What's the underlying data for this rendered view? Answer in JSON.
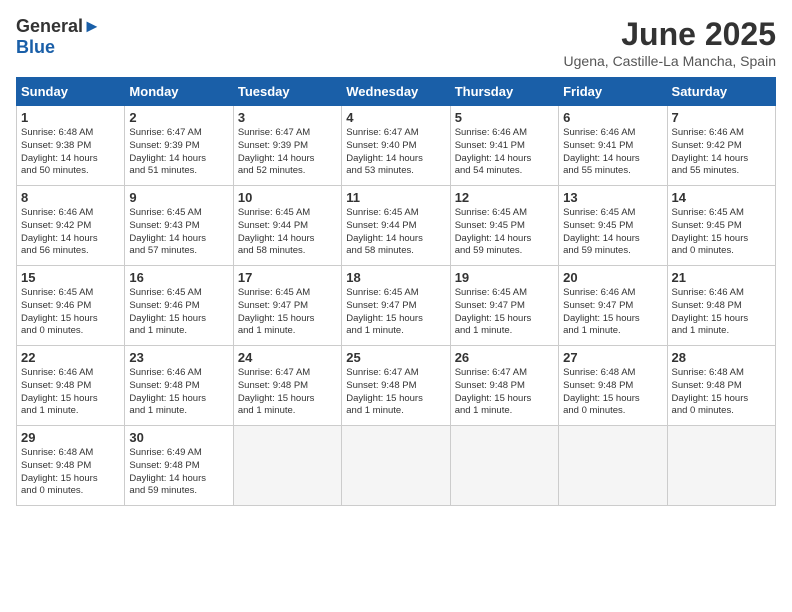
{
  "logo": {
    "general": "General",
    "blue": "Blue"
  },
  "title": "June 2025",
  "subtitle": "Ugena, Castille-La Mancha, Spain",
  "headers": [
    "Sunday",
    "Monday",
    "Tuesday",
    "Wednesday",
    "Thursday",
    "Friday",
    "Saturday"
  ],
  "weeks": [
    [
      {
        "day": "1",
        "lines": [
          "Sunrise: 6:48 AM",
          "Sunset: 9:38 PM",
          "Daylight: 14 hours",
          "and 50 minutes."
        ]
      },
      {
        "day": "2",
        "lines": [
          "Sunrise: 6:47 AM",
          "Sunset: 9:39 PM",
          "Daylight: 14 hours",
          "and 51 minutes."
        ]
      },
      {
        "day": "3",
        "lines": [
          "Sunrise: 6:47 AM",
          "Sunset: 9:39 PM",
          "Daylight: 14 hours",
          "and 52 minutes."
        ]
      },
      {
        "day": "4",
        "lines": [
          "Sunrise: 6:47 AM",
          "Sunset: 9:40 PM",
          "Daylight: 14 hours",
          "and 53 minutes."
        ]
      },
      {
        "day": "5",
        "lines": [
          "Sunrise: 6:46 AM",
          "Sunset: 9:41 PM",
          "Daylight: 14 hours",
          "and 54 minutes."
        ]
      },
      {
        "day": "6",
        "lines": [
          "Sunrise: 6:46 AM",
          "Sunset: 9:41 PM",
          "Daylight: 14 hours",
          "and 55 minutes."
        ]
      },
      {
        "day": "7",
        "lines": [
          "Sunrise: 6:46 AM",
          "Sunset: 9:42 PM",
          "Daylight: 14 hours",
          "and 55 minutes."
        ]
      }
    ],
    [
      {
        "day": "8",
        "lines": [
          "Sunrise: 6:46 AM",
          "Sunset: 9:42 PM",
          "Daylight: 14 hours",
          "and 56 minutes."
        ]
      },
      {
        "day": "9",
        "lines": [
          "Sunrise: 6:45 AM",
          "Sunset: 9:43 PM",
          "Daylight: 14 hours",
          "and 57 minutes."
        ]
      },
      {
        "day": "10",
        "lines": [
          "Sunrise: 6:45 AM",
          "Sunset: 9:44 PM",
          "Daylight: 14 hours",
          "and 58 minutes."
        ]
      },
      {
        "day": "11",
        "lines": [
          "Sunrise: 6:45 AM",
          "Sunset: 9:44 PM",
          "Daylight: 14 hours",
          "and 58 minutes."
        ]
      },
      {
        "day": "12",
        "lines": [
          "Sunrise: 6:45 AM",
          "Sunset: 9:45 PM",
          "Daylight: 14 hours",
          "and 59 minutes."
        ]
      },
      {
        "day": "13",
        "lines": [
          "Sunrise: 6:45 AM",
          "Sunset: 9:45 PM",
          "Daylight: 14 hours",
          "and 59 minutes."
        ]
      },
      {
        "day": "14",
        "lines": [
          "Sunrise: 6:45 AM",
          "Sunset: 9:45 PM",
          "Daylight: 15 hours",
          "and 0 minutes."
        ]
      }
    ],
    [
      {
        "day": "15",
        "lines": [
          "Sunrise: 6:45 AM",
          "Sunset: 9:46 PM",
          "Daylight: 15 hours",
          "and 0 minutes."
        ]
      },
      {
        "day": "16",
        "lines": [
          "Sunrise: 6:45 AM",
          "Sunset: 9:46 PM",
          "Daylight: 15 hours",
          "and 1 minute."
        ]
      },
      {
        "day": "17",
        "lines": [
          "Sunrise: 6:45 AM",
          "Sunset: 9:47 PM",
          "Daylight: 15 hours",
          "and 1 minute."
        ]
      },
      {
        "day": "18",
        "lines": [
          "Sunrise: 6:45 AM",
          "Sunset: 9:47 PM",
          "Daylight: 15 hours",
          "and 1 minute."
        ]
      },
      {
        "day": "19",
        "lines": [
          "Sunrise: 6:45 AM",
          "Sunset: 9:47 PM",
          "Daylight: 15 hours",
          "and 1 minute."
        ]
      },
      {
        "day": "20",
        "lines": [
          "Sunrise: 6:46 AM",
          "Sunset: 9:47 PM",
          "Daylight: 15 hours",
          "and 1 minute."
        ]
      },
      {
        "day": "21",
        "lines": [
          "Sunrise: 6:46 AM",
          "Sunset: 9:48 PM",
          "Daylight: 15 hours",
          "and 1 minute."
        ]
      }
    ],
    [
      {
        "day": "22",
        "lines": [
          "Sunrise: 6:46 AM",
          "Sunset: 9:48 PM",
          "Daylight: 15 hours",
          "and 1 minute."
        ]
      },
      {
        "day": "23",
        "lines": [
          "Sunrise: 6:46 AM",
          "Sunset: 9:48 PM",
          "Daylight: 15 hours",
          "and 1 minute."
        ]
      },
      {
        "day": "24",
        "lines": [
          "Sunrise: 6:47 AM",
          "Sunset: 9:48 PM",
          "Daylight: 15 hours",
          "and 1 minute."
        ]
      },
      {
        "day": "25",
        "lines": [
          "Sunrise: 6:47 AM",
          "Sunset: 9:48 PM",
          "Daylight: 15 hours",
          "and 1 minute."
        ]
      },
      {
        "day": "26",
        "lines": [
          "Sunrise: 6:47 AM",
          "Sunset: 9:48 PM",
          "Daylight: 15 hours",
          "and 1 minute."
        ]
      },
      {
        "day": "27",
        "lines": [
          "Sunrise: 6:48 AM",
          "Sunset: 9:48 PM",
          "Daylight: 15 hours",
          "and 0 minutes."
        ]
      },
      {
        "day": "28",
        "lines": [
          "Sunrise: 6:48 AM",
          "Sunset: 9:48 PM",
          "Daylight: 15 hours",
          "and 0 minutes."
        ]
      }
    ],
    [
      {
        "day": "29",
        "lines": [
          "Sunrise: 6:48 AM",
          "Sunset: 9:48 PM",
          "Daylight: 15 hours",
          "and 0 minutes."
        ]
      },
      {
        "day": "30",
        "lines": [
          "Sunrise: 6:49 AM",
          "Sunset: 9:48 PM",
          "Daylight: 14 hours",
          "and 59 minutes."
        ]
      },
      {
        "day": "",
        "lines": []
      },
      {
        "day": "",
        "lines": []
      },
      {
        "day": "",
        "lines": []
      },
      {
        "day": "",
        "lines": []
      },
      {
        "day": "",
        "lines": []
      }
    ]
  ]
}
